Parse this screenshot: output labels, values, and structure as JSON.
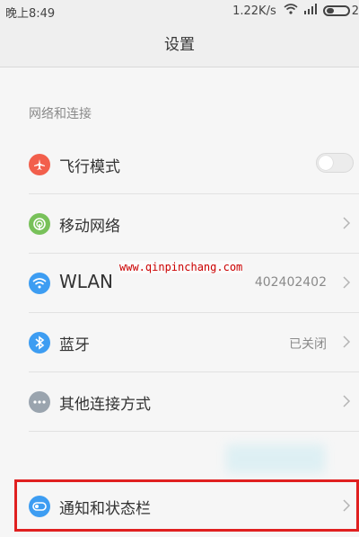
{
  "status_bar": {
    "time": "晚上8:49",
    "speed": "1.22K/s",
    "battery": "2"
  },
  "title": "设置",
  "section": "网络和连接",
  "rows": [
    {
      "label": "飞行模式",
      "icon": "airplane-icon",
      "color": "#f25f4c",
      "control": "toggle-off"
    },
    {
      "label": "移动网络",
      "icon": "mobile-network-icon",
      "color": "#78c15a",
      "control": "chevron"
    },
    {
      "label": "WLAN",
      "value": "402402402",
      "icon": "wifi-icon",
      "color": "#3d9df2",
      "control": "chevron"
    },
    {
      "label": "蓝牙",
      "value": "已关闭",
      "icon": "bluetooth-icon",
      "color": "#3d9df2",
      "control": "chevron"
    },
    {
      "label": "其他连接方式",
      "icon": "more-icon",
      "color": "#9aa4ae",
      "control": "chevron"
    },
    {
      "label": "通知和状态栏",
      "icon": "notification-icon",
      "color": "#3d9df2",
      "control": "chevron"
    }
  ],
  "watermark": "www.qinpinchang.com",
  "highlight_color": "#e02020"
}
